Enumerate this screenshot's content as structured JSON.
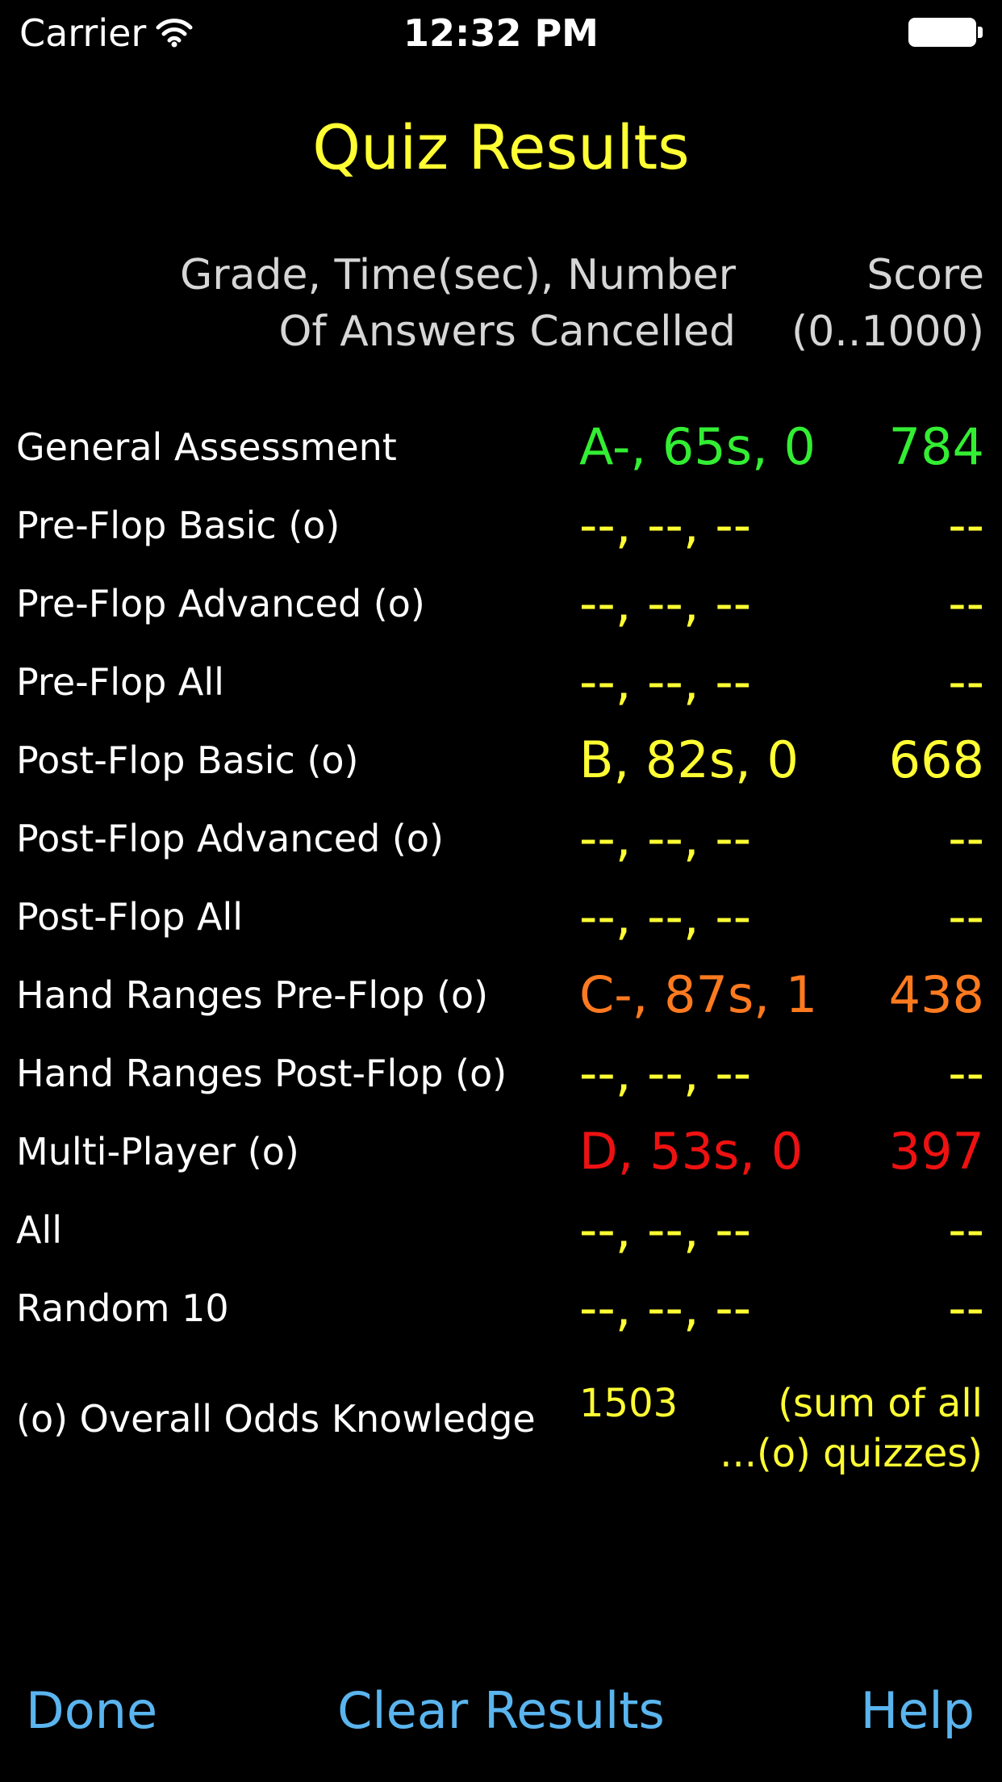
{
  "status_bar": {
    "carrier": "Carrier",
    "time": "12:32 PM",
    "wifi_icon": "wifi-icon",
    "battery_icon": "battery-icon"
  },
  "title": "Quiz Results",
  "columns": {
    "grade_header_line1": "Grade, Time(sec), Number",
    "grade_header_line2": "Of Answers Cancelled",
    "score_header_line1": "Score",
    "score_header_line2": "(0..1000)"
  },
  "colors": {
    "background": "#000000",
    "title": "#ffff33",
    "green": "#33ee33",
    "yellow": "#ffff33",
    "orange": "#ff7a1f",
    "red": "#ee1111",
    "toolbar": "#5ab4ee"
  },
  "results": [
    {
      "label": "General Assessment",
      "grade": "A-, 65s, 0",
      "score": "784",
      "color": "#33ee33"
    },
    {
      "label": "Pre-Flop Basic (o)",
      "grade": "--, --, --",
      "score": "--",
      "color": "#ffff33"
    },
    {
      "label": "Pre-Flop Advanced (o)",
      "grade": "--, --, --",
      "score": "--",
      "color": "#ffff33"
    },
    {
      "label": "Pre-Flop All",
      "grade": "--, --, --",
      "score": "--",
      "color": "#ffff33"
    },
    {
      "label": "Post-Flop Basic (o)",
      "grade": "B, 82s, 0",
      "score": "668",
      "color": "#ffff33"
    },
    {
      "label": "Post-Flop Advanced (o)",
      "grade": "--, --, --",
      "score": "--",
      "color": "#ffff33"
    },
    {
      "label": "Post-Flop All",
      "grade": "--, --, --",
      "score": "--",
      "color": "#ffff33"
    },
    {
      "label": "Hand Ranges Pre-Flop (o)",
      "grade": "C-, 87s, 1",
      "score": "438",
      "color": "#ff7a1f"
    },
    {
      "label": "Hand Ranges Post-Flop (o)",
      "grade": "--, --, --",
      "score": "--",
      "color": "#ffff33"
    },
    {
      "label": "Multi-Player (o)",
      "grade": "D, 53s, 0",
      "score": "397",
      "color": "#ee1111"
    },
    {
      "label": "All",
      "grade": "--, --, --",
      "score": "--",
      "color": "#ffff33"
    },
    {
      "label": "Random 10",
      "grade": "--, --, --",
      "score": "--",
      "color": "#ffff33"
    }
  ],
  "overall": {
    "label": "(o) Overall Odds Knowledge",
    "value": "1503",
    "note_line1": "(sum of all",
    "note_line2": "...(o) quizzes)"
  },
  "toolbar": {
    "done": "Done",
    "clear": "Clear Results",
    "help": "Help"
  }
}
